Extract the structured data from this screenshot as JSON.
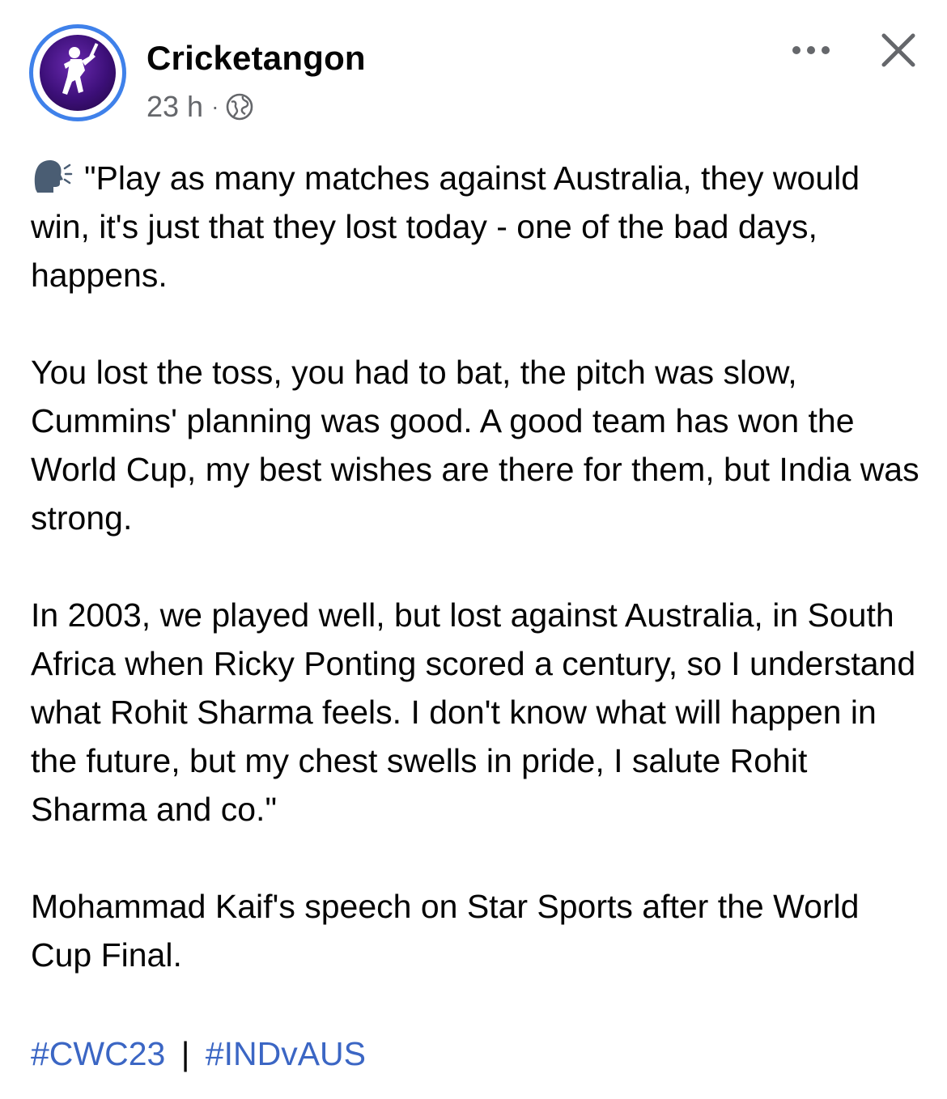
{
  "post": {
    "page_name": "Cricketangon",
    "time": "23 h",
    "separator_dot": "·",
    "audience_icon": "globe-icon",
    "avatar_icon": "cricket-batsman-logo"
  },
  "actions": {
    "more_icon": "more-horizontal-icon",
    "close_icon": "close-icon"
  },
  "body": {
    "speak_icon": "speaking-head-emoji",
    "para1": "\"Play as many matches against Australia, they would win, it's just that they lost today - one of the bad days, happens.",
    "para2": "You lost the toss, you had to bat, the pitch was slow, Cummins' planning was good. A good team has won the World Cup, my best wishes are there for them, but India was strong.",
    "para3": "In 2003, we played well, but lost against Australia, in South Africa when Ricky Ponting scored a century, so I understand what Rohit Sharma feels. I don't know what will happen in the future, but my chest swells in pride, I salute Rohit Sharma and co.\"",
    "para4": "Mohammad Kaif's speech on Star Sports after the World Cup Final."
  },
  "hashtags": {
    "tag1": "#CWC23",
    "divider": "|",
    "tag2": "#INDvAUS"
  },
  "colors": {
    "avatar_ring": "#3f81ea",
    "hashtag": "#3b66c4",
    "meta_text": "#65676b"
  }
}
